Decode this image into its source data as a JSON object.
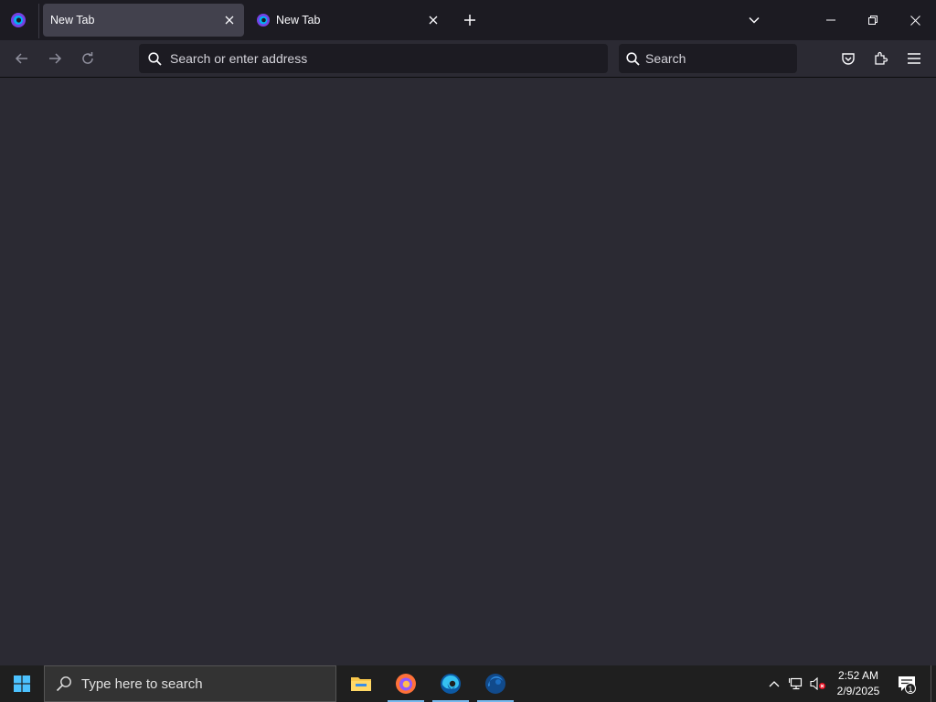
{
  "browser": {
    "tabs": [
      {
        "title": "New Tab",
        "active": true
      },
      {
        "title": "New Tab",
        "active": false
      }
    ],
    "urlbar": {
      "placeholder": "Search or enter address"
    },
    "searchbar": {
      "placeholder": "Search"
    }
  },
  "taskbar": {
    "search_placeholder": "Type here to search",
    "apps": [
      "file-explorer",
      "firefox",
      "edge",
      "edge-beta"
    ],
    "clock": {
      "time": "2:52 AM",
      "date": "2/9/2025"
    },
    "notification_count": "1"
  },
  "colors": {
    "tab_strip": "#1c1b22",
    "toolbar": "#2b2a33",
    "active_tab": "#42414d",
    "taskbar": "#1f1f1f",
    "accent": "#76b9ed"
  }
}
